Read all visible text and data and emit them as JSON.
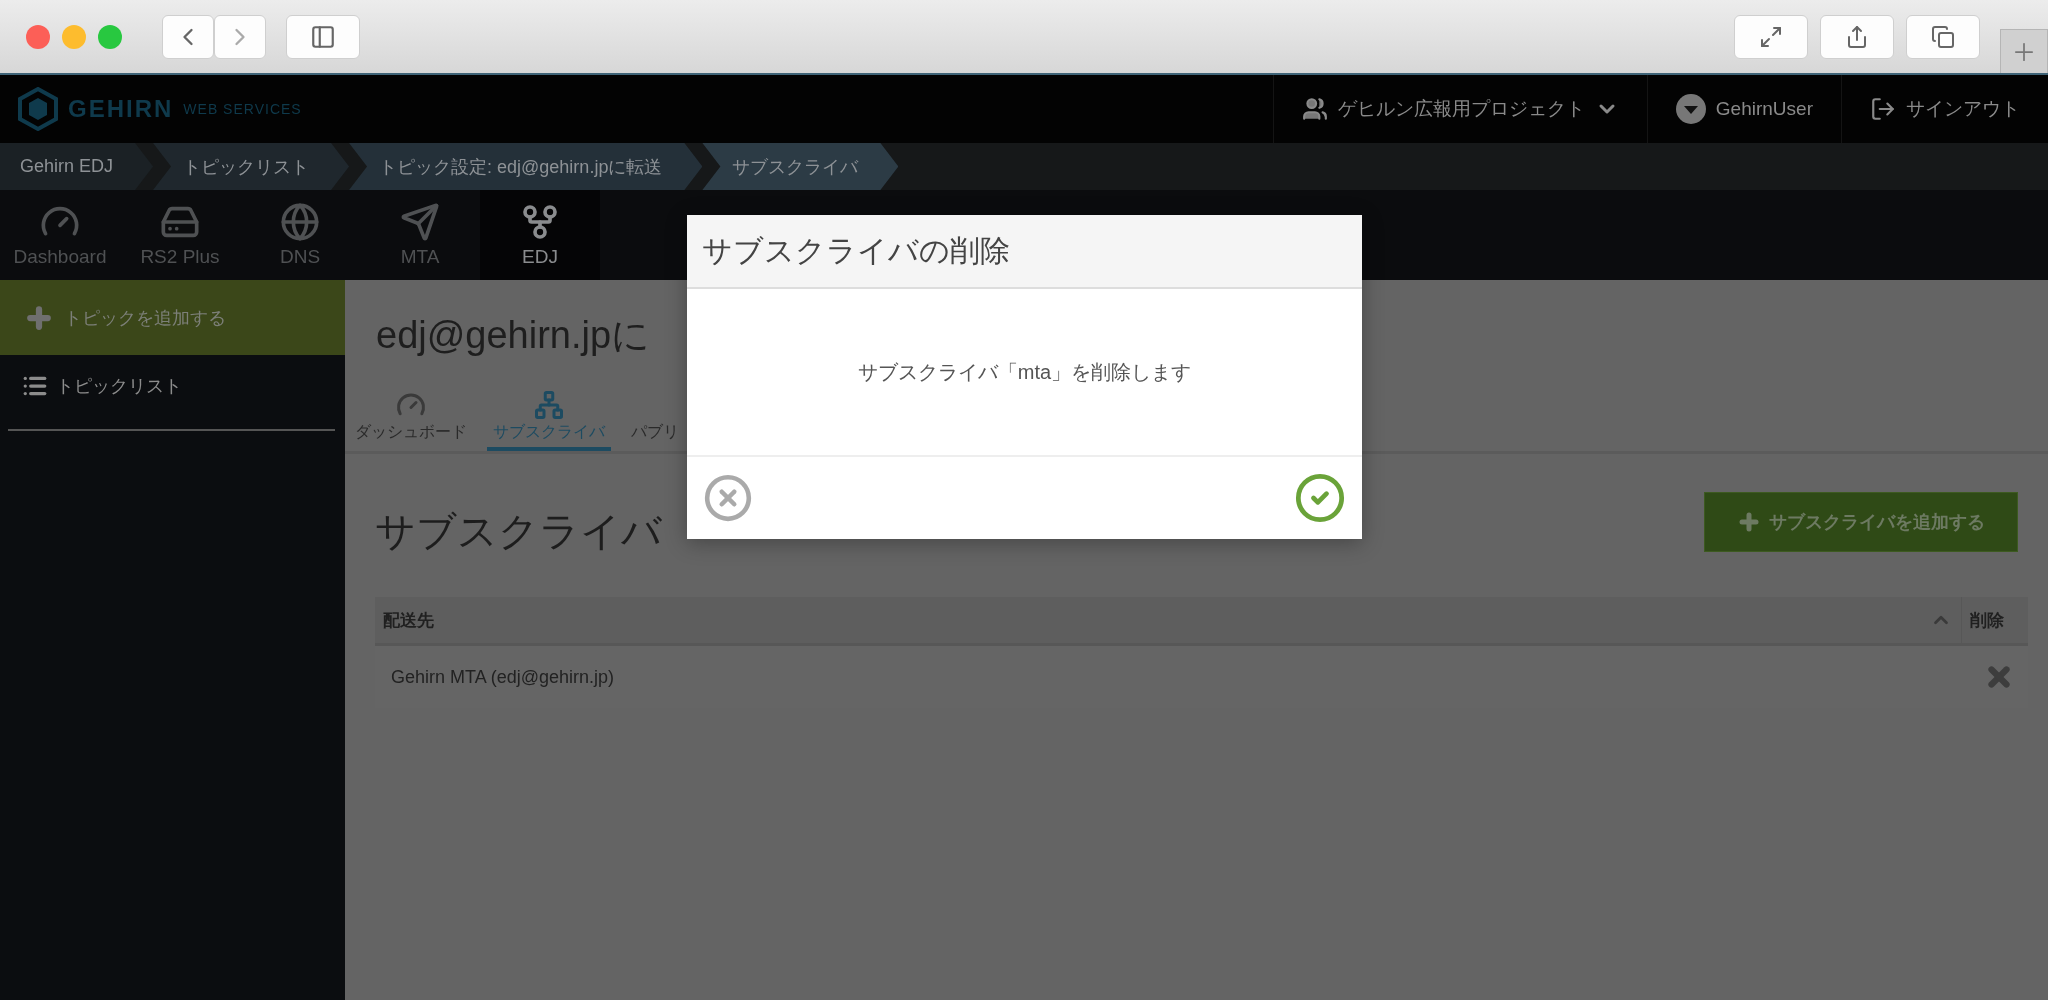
{
  "header": {
    "logo_name": "GEHIRN",
    "logo_tagline": "WEB SERVICES",
    "project": "ゲヒルン広報用プロジェクト",
    "user": "GehirnUser",
    "signout": "サインアウト"
  },
  "breadcrumb": [
    "Gehirn EDJ",
    "トピックリスト",
    "トピック設定: edj@gehirn.jpに転送",
    "サブスクライバ"
  ],
  "services": [
    {
      "label": "Dashboard",
      "kind": "gauge",
      "selected": false
    },
    {
      "label": "RS2 Plus",
      "kind": "drive",
      "selected": false
    },
    {
      "label": "DNS",
      "kind": "globe",
      "selected": false
    },
    {
      "label": "MTA",
      "kind": "plane",
      "selected": false
    },
    {
      "label": "EDJ",
      "kind": "fork",
      "selected": true
    }
  ],
  "sidebar": {
    "add_button": "トピックを追加する",
    "items": [
      "トピックリスト"
    ]
  },
  "page": {
    "title": "edj@gehirn.jpに",
    "tabs": [
      {
        "label": "ダッシュボード",
        "kind": "gauge",
        "selected": false
      },
      {
        "label": "サブスクライバ",
        "kind": "sitemap",
        "selected": true
      },
      {
        "label": "パブリ",
        "selected": false
      }
    ],
    "section_title": "サブスクライバ",
    "add_button": "サブスクライバを追加する",
    "table": {
      "columns": [
        "配送先",
        "削除"
      ],
      "rows": [
        {
          "destination": "Gehirn MTA (edj@gehirn.jp)"
        }
      ]
    }
  },
  "dialog": {
    "title": "サブスクライバの削除",
    "message": "サブスクライバ「mta」を削除します"
  }
}
